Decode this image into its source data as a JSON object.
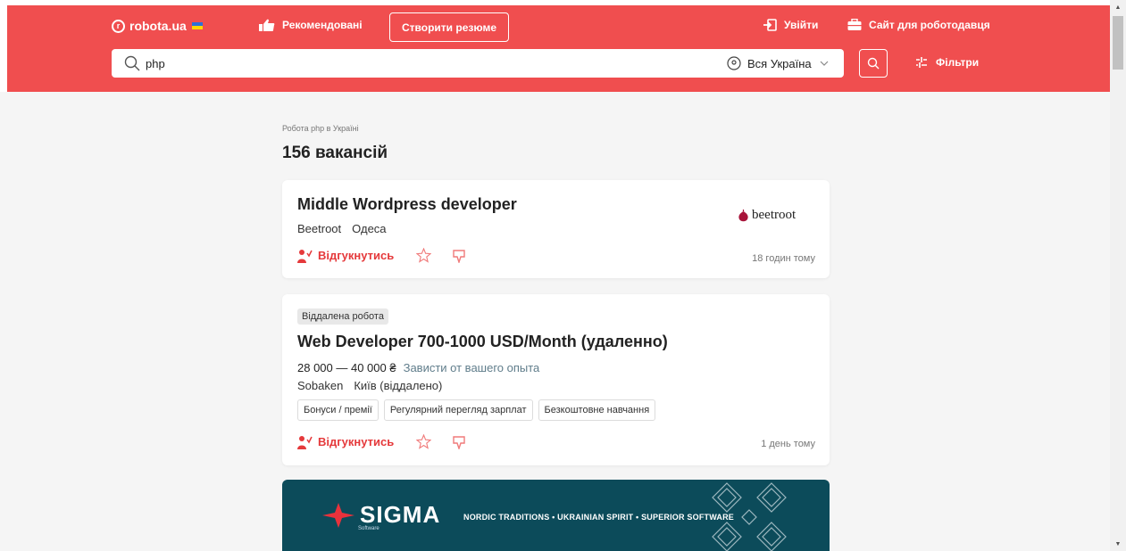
{
  "header": {
    "logo_text": "robota.ua",
    "recommended_label": "Рекомендовані",
    "create_cv_label": "Створити резюме",
    "login_label": "Увійти",
    "employer_label": "Сайт для роботодавця",
    "search_value": "php",
    "location_value": "Вся Україна",
    "filters_label": "Фільтри",
    "brand_color": "#f04e4f"
  },
  "main": {
    "breadcrumb": "Робота php в Україні",
    "count_title": "156 вакансій"
  },
  "jobs": [
    {
      "title": "Middle Wordpress developer",
      "company": "Beetroot",
      "city": "Одеса",
      "logo_text": "beetroot",
      "apply_label": "Відгукнутись",
      "time": "18 годин тому"
    },
    {
      "tag": "Віддалена робота",
      "title": "Web Developer 700-1000 USD/Month (удаленно)",
      "salary": "28 000 — 40 000 ₴",
      "salary_note": "Зависти от вашего опыта",
      "company": "Sobaken",
      "city": "Київ (віддалено)",
      "benefits": [
        "Бонуси / премії",
        "Регулярний перегляд зарплат",
        "Безкоштовне навчання"
      ],
      "apply_label": "Відгукнутись",
      "time": "1 день тому"
    }
  ],
  "banner": {
    "brand": "SIGMA",
    "brand_sub": "Software",
    "slogan": "NORDIC TRADITIONS • UKRAINIAN SPIRIT • SUPERIOR SOFTWARE",
    "bg_color": "#0c4b5a"
  }
}
